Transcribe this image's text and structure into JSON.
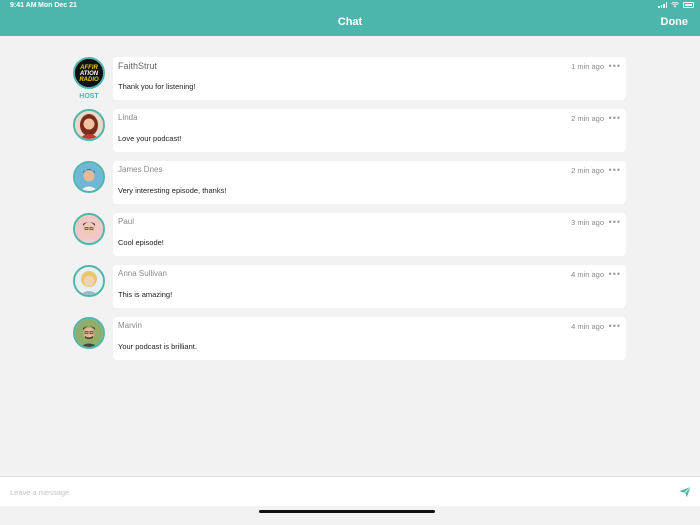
{
  "status_bar": {
    "time": "9:41 AM",
    "date": "Mon Dec 21"
  },
  "nav": {
    "title": "Chat",
    "done_label": "Done"
  },
  "colors": {
    "accent": "#4db6ac",
    "background": "#f2f2f2",
    "bubble": "#ffffff"
  },
  "messages": [
    {
      "author": "FaithStrut",
      "time": "1 min ago",
      "text": "Thank you for listening!",
      "is_host": true,
      "host_label": "HOST",
      "avatar_logo_text": "AFFIRMATION RADIO"
    },
    {
      "author": "Linda",
      "time": "2 min ago",
      "text": "Love your podcast!"
    },
    {
      "author": "James Dnes",
      "time": "2 min ago",
      "text": "Very interesting episode, thanks!"
    },
    {
      "author": "Paul",
      "time": "3 min ago",
      "text": "Cool episode!"
    },
    {
      "author": "Anna Sullivan",
      "time": "4 min ago",
      "text": "This is amazing!"
    },
    {
      "author": "Marvin",
      "time": "4 min ago",
      "text": "Your podcast is brilliant."
    }
  ],
  "more_icon": "ellipsis-icon",
  "composer": {
    "placeholder": "Leave a message",
    "send_icon": "paper-plane-icon"
  }
}
